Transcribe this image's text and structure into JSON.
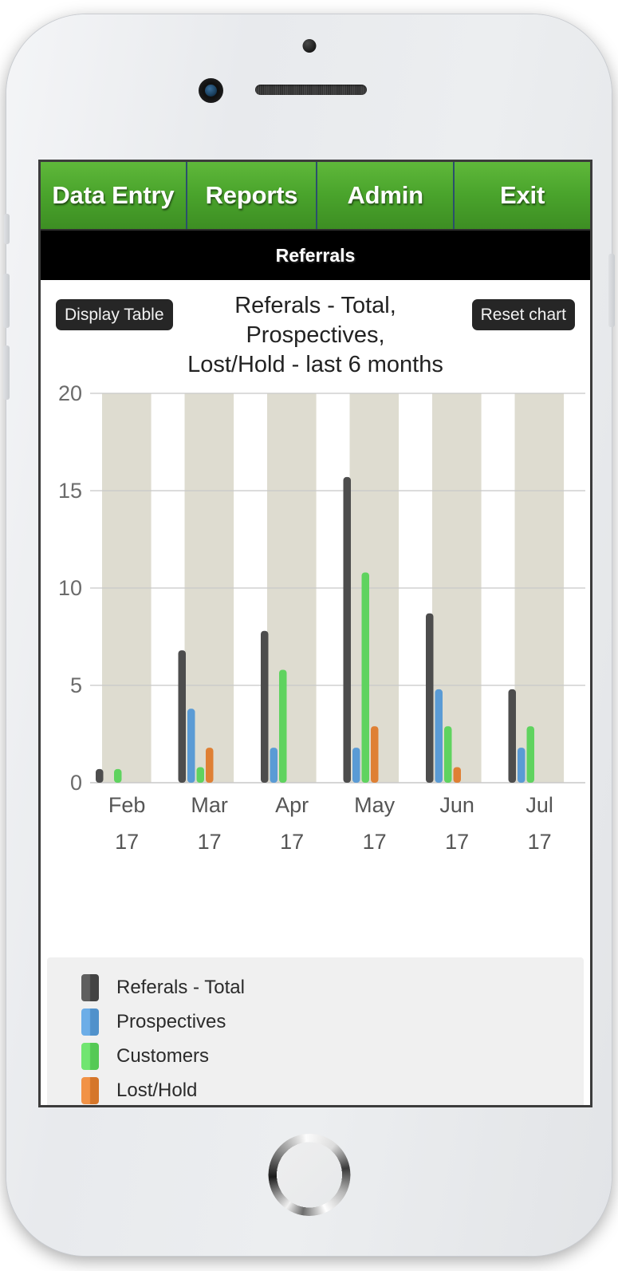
{
  "device": {
    "name": "smartphone-mockup",
    "sensor_icon": "proximity-sensor-icon",
    "camera_icon": "front-camera-icon",
    "speaker_icon": "earpiece-speaker-icon",
    "home_button_icon": "home-button-icon"
  },
  "nav": {
    "tabs": [
      {
        "label": "Data Entry",
        "name": "nav-tab-data-entry"
      },
      {
        "label": "Reports",
        "name": "nav-tab-reports"
      },
      {
        "label": "Admin",
        "name": "nav-tab-admin"
      },
      {
        "label": "Exit",
        "name": "nav-tab-exit"
      }
    ]
  },
  "header": {
    "title": "Referrals"
  },
  "toolbar": {
    "display_table_label": "Display Table",
    "reset_chart_label": "Reset chart"
  },
  "chart_title_lines": {
    "line1": "Referals - Total,",
    "line2": "Prospectives,",
    "line3": "Lost/Hold - last 6 months"
  },
  "colors": {
    "total": "#4d4d4d",
    "prospectives": "#5a9bd5",
    "customers": "#5fd35f",
    "lost_hold": "#df8034",
    "band": "#dedcd0",
    "grid": "#c8c8c8",
    "nav_green_top": "#5fb83a",
    "nav_green_bottom": "#3d8e23",
    "title_bar_bg": "#000000",
    "legend_bg": "#f0f0f0"
  },
  "chart_data": {
    "type": "bar",
    "title": "Referals - Total, Prospectives, Lost/Hold - last 6 months",
    "xlabel": "",
    "ylabel": "",
    "ylim": [
      0,
      20
    ],
    "yticks": [
      0,
      5,
      10,
      15,
      20
    ],
    "ytick_labels": [
      "0",
      "5",
      "10",
      "15",
      "20"
    ],
    "grid": true,
    "legend_position": "bottom-left",
    "categories": [
      "Feb",
      "Mar",
      "Apr",
      "May",
      "Jun",
      "Jul"
    ],
    "category_sublabels": [
      "17",
      "17",
      "17",
      "17",
      "17",
      "17"
    ],
    "series": [
      {
        "name": "Referals - Total",
        "color": "#4d4d4d",
        "values": [
          0.7,
          6.8,
          7.8,
          15.7,
          8.7,
          4.8
        ]
      },
      {
        "name": "Prospectives",
        "color": "#5a9bd5",
        "values": [
          0,
          3.8,
          1.8,
          1.8,
          4.8,
          1.8
        ]
      },
      {
        "name": "Customers",
        "color": "#5fd35f",
        "values": [
          0.7,
          0.8,
          5.8,
          10.8,
          2.9,
          2.9
        ]
      },
      {
        "name": "Lost/Hold",
        "color": "#df8034",
        "values": [
          0,
          1.8,
          0,
          2.9,
          0.8,
          0
        ]
      }
    ]
  },
  "legend": {
    "items": [
      {
        "label": "Referals - Total",
        "color": "#4d4d4d"
      },
      {
        "label": "Prospectives",
        "color": "#5a9bd5"
      },
      {
        "label": "Customers",
        "color": "#5fd35f"
      },
      {
        "label": "Lost/Hold",
        "color": "#df8034"
      }
    ]
  }
}
